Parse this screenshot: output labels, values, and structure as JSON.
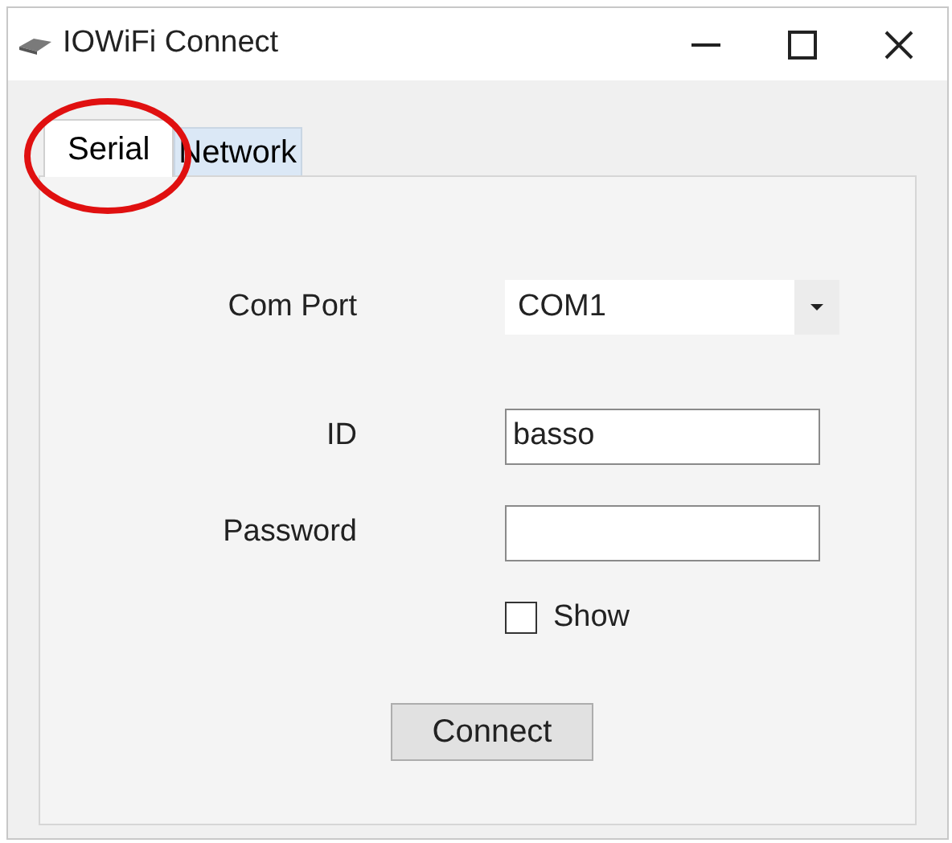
{
  "window": {
    "title": "IOWiFi Connect"
  },
  "tabs": [
    {
      "label": "Serial",
      "selected": true,
      "annotated": true
    },
    {
      "label": "Network",
      "selected": false,
      "annotated": false
    }
  ],
  "form": {
    "com_port": {
      "label": "Com Port",
      "value": "COM1"
    },
    "id": {
      "label": "ID",
      "value": "basso"
    },
    "password": {
      "label": "Password"
    },
    "show": {
      "label": "Show",
      "checked": false
    },
    "connect_button": "Connect"
  }
}
